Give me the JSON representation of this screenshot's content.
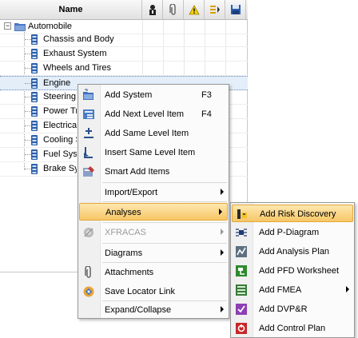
{
  "header": {
    "name_col": "Name"
  },
  "tree": {
    "root": "Automobile",
    "items": [
      {
        "label": "Chassis and Body"
      },
      {
        "label": "Exhaust System"
      },
      {
        "label": "Wheels and Tires"
      },
      {
        "label": "Engine"
      },
      {
        "label": "Steering"
      },
      {
        "label": "Power Tr"
      },
      {
        "label": "Electrical"
      },
      {
        "label": "Cooling S"
      },
      {
        "label": "Fuel Syst"
      },
      {
        "label": "Brake Sy"
      }
    ]
  },
  "context_menu": {
    "items": [
      {
        "label": "Add System",
        "shortcut": "F3",
        "icon": "folder-add-icon"
      },
      {
        "label": "Add Next Level Item",
        "shortcut": "F4",
        "icon": "next-level-icon"
      },
      {
        "label": "Add Same Level Item",
        "shortcut": "",
        "icon": "same-level-icon"
      },
      {
        "label": "Insert Same Level Item",
        "shortcut": "",
        "icon": "insert-level-icon"
      },
      {
        "label": "Smart Add Items",
        "shortcut": "",
        "icon": "smart-add-icon"
      },
      {
        "label": "Import/Export",
        "submenu": true
      },
      {
        "label": "Analyses",
        "submenu": true,
        "highlighted": true
      },
      {
        "label": "XFRACAS",
        "submenu": true,
        "disabled": true,
        "icon": "xfracas-icon"
      },
      {
        "label": "Diagrams",
        "submenu": true
      },
      {
        "label": "Attachments",
        "icon": "paperclip-icon"
      },
      {
        "label": "Save Locator Link",
        "icon": "locator-link-icon"
      },
      {
        "label": "Expand/Collapse",
        "submenu": true
      }
    ]
  },
  "analyses_submenu": {
    "items": [
      {
        "label": "Add Risk Discovery",
        "highlighted": true,
        "icon": "risk-discovery-icon"
      },
      {
        "label": "Add P-Diagram",
        "icon": "p-diagram-icon"
      },
      {
        "label": "Add Analysis Plan",
        "icon": "analysis-plan-icon"
      },
      {
        "label": "Add PFD Worksheet",
        "icon": "pfd-worksheet-icon"
      },
      {
        "label": "Add FMEA",
        "submenu": true,
        "icon": "fmea-icon"
      },
      {
        "label": "Add DVP&R",
        "icon": "dvpr-icon"
      },
      {
        "label": "Add Control Plan",
        "icon": "control-plan-icon"
      }
    ]
  },
  "colors": {
    "highlight_fill": "#f7c766",
    "highlight_border": "#e3a83a",
    "selection": "#e3eef9"
  }
}
